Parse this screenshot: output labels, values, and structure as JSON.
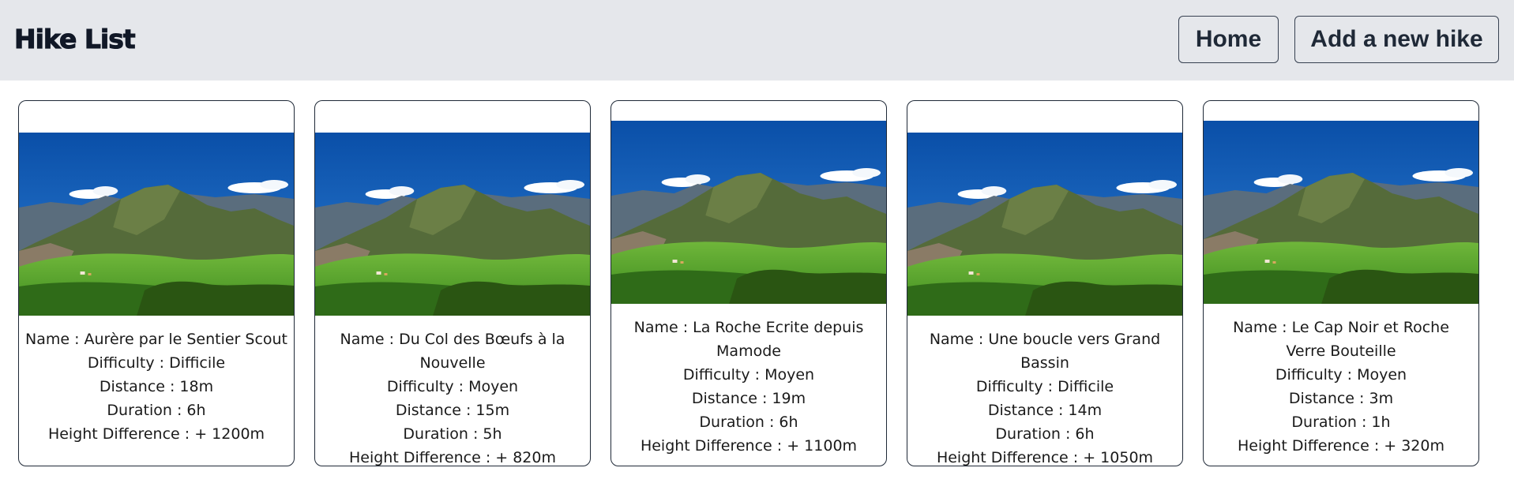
{
  "header": {
    "title": "Hike List",
    "nav": {
      "home_label": "Home",
      "add_label": "Add a new hike"
    },
    "background": "#e5e7eb"
  },
  "cards": [
    {
      "image": "mountain-landscape-image",
      "name": "Name : Aurère par le Sentier Scout",
      "difficulty": "Difficulty : Difficile",
      "distance": "Distance : 18m",
      "duration": "Duration : 6h",
      "height": "Height Difference : + 1200m"
    },
    {
      "image": "mountain-landscape-image",
      "name": "Name : Du Col des Bœufs à la Nouvelle",
      "difficulty": "Difficulty : Moyen",
      "distance": "Distance : 15m",
      "duration": "Duration : 5h",
      "height": "Height Difference : + 820m"
    },
    {
      "image": "mountain-landscape-image",
      "name": "Name : La Roche Ecrite depuis Mamode",
      "difficulty": "Difficulty : Moyen",
      "distance": "Distance : 19m",
      "duration": "Duration : 6h",
      "height": "Height Difference : + 1100m"
    },
    {
      "image": "mountain-landscape-image",
      "name": "Name : Une boucle vers Grand Bassin",
      "difficulty": "Difficulty : Difficile",
      "distance": "Distance : 14m",
      "duration": "Duration : 6h",
      "height": "Height Difference : + 1050m"
    },
    {
      "image": "mountain-landscape-image",
      "name": "Name : Le Cap Noir et Roche Verre Bouteille",
      "difficulty": "Difficulty : Moyen",
      "distance": "Distance : 3m",
      "duration": "Duration : 1h",
      "height": "Height Difference : + 320m"
    }
  ]
}
